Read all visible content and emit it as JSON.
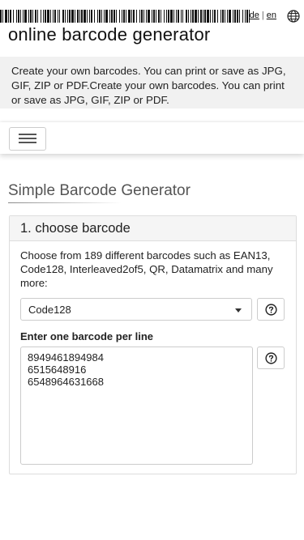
{
  "header": {
    "lang_de": "de",
    "lang_sep": "|",
    "lang_en": "en",
    "globe_icon": "globe-icon",
    "site_title": "online barcode generator"
  },
  "intro": {
    "text": "Create your own barcodes. You can print or save as JPG, GIF, ZIP or PDF.Create your own barcodes. You can print or save as JPG, GIF, ZIP or PDF."
  },
  "nav": {
    "menu_icon": "hamburger-menu-icon"
  },
  "main": {
    "section_title": "Simple Barcode Generator",
    "card": {
      "title": "1. choose barcode",
      "description": "Choose from 189 different barcodes such as EAN13, Code128, Interleaved2of5, QR, Datamatrix and many more:",
      "select_value": "Code128",
      "textarea_label": "Enter one barcode per line",
      "textarea_value": "8949461894984\n6515648916\n6548964631668",
      "help_icon": "question-circle-icon"
    }
  },
  "colors": {
    "intro_bg": "#f1f1f1",
    "card_header_bg": "#f5f5f5",
    "border": "#cccccc"
  }
}
